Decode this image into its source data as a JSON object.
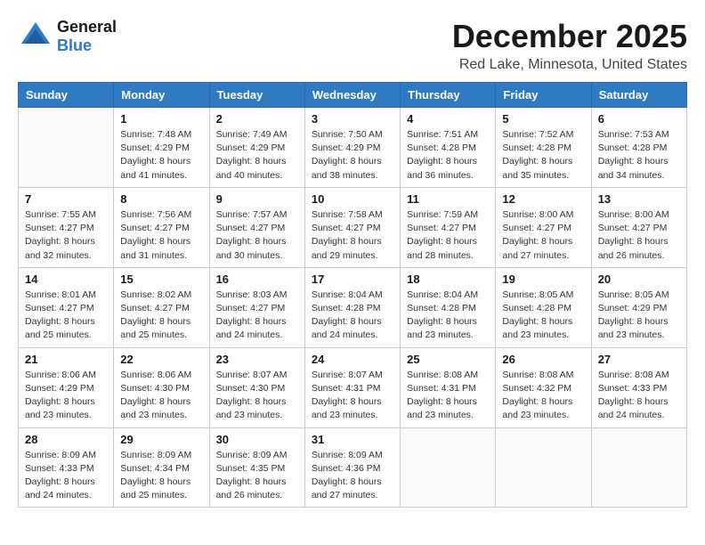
{
  "header": {
    "logo_line1": "General",
    "logo_line2": "Blue",
    "month": "December 2025",
    "location": "Red Lake, Minnesota, United States"
  },
  "calendar": {
    "days_of_week": [
      "Sunday",
      "Monday",
      "Tuesday",
      "Wednesday",
      "Thursday",
      "Friday",
      "Saturday"
    ],
    "weeks": [
      [
        {
          "day": "",
          "info": ""
        },
        {
          "day": "1",
          "info": "Sunrise: 7:48 AM\nSunset: 4:29 PM\nDaylight: 8 hours\nand 41 minutes."
        },
        {
          "day": "2",
          "info": "Sunrise: 7:49 AM\nSunset: 4:29 PM\nDaylight: 8 hours\nand 40 minutes."
        },
        {
          "day": "3",
          "info": "Sunrise: 7:50 AM\nSunset: 4:29 PM\nDaylight: 8 hours\nand 38 minutes."
        },
        {
          "day": "4",
          "info": "Sunrise: 7:51 AM\nSunset: 4:28 PM\nDaylight: 8 hours\nand 36 minutes."
        },
        {
          "day": "5",
          "info": "Sunrise: 7:52 AM\nSunset: 4:28 PM\nDaylight: 8 hours\nand 35 minutes."
        },
        {
          "day": "6",
          "info": "Sunrise: 7:53 AM\nSunset: 4:28 PM\nDaylight: 8 hours\nand 34 minutes."
        }
      ],
      [
        {
          "day": "7",
          "info": "Sunrise: 7:55 AM\nSunset: 4:27 PM\nDaylight: 8 hours\nand 32 minutes."
        },
        {
          "day": "8",
          "info": "Sunrise: 7:56 AM\nSunset: 4:27 PM\nDaylight: 8 hours\nand 31 minutes."
        },
        {
          "day": "9",
          "info": "Sunrise: 7:57 AM\nSunset: 4:27 PM\nDaylight: 8 hours\nand 30 minutes."
        },
        {
          "day": "10",
          "info": "Sunrise: 7:58 AM\nSunset: 4:27 PM\nDaylight: 8 hours\nand 29 minutes."
        },
        {
          "day": "11",
          "info": "Sunrise: 7:59 AM\nSunset: 4:27 PM\nDaylight: 8 hours\nand 28 minutes."
        },
        {
          "day": "12",
          "info": "Sunrise: 8:00 AM\nSunset: 4:27 PM\nDaylight: 8 hours\nand 27 minutes."
        },
        {
          "day": "13",
          "info": "Sunrise: 8:00 AM\nSunset: 4:27 PM\nDaylight: 8 hours\nand 26 minutes."
        }
      ],
      [
        {
          "day": "14",
          "info": "Sunrise: 8:01 AM\nSunset: 4:27 PM\nDaylight: 8 hours\nand 25 minutes."
        },
        {
          "day": "15",
          "info": "Sunrise: 8:02 AM\nSunset: 4:27 PM\nDaylight: 8 hours\nand 25 minutes."
        },
        {
          "day": "16",
          "info": "Sunrise: 8:03 AM\nSunset: 4:27 PM\nDaylight: 8 hours\nand 24 minutes."
        },
        {
          "day": "17",
          "info": "Sunrise: 8:04 AM\nSunset: 4:28 PM\nDaylight: 8 hours\nand 24 minutes."
        },
        {
          "day": "18",
          "info": "Sunrise: 8:04 AM\nSunset: 4:28 PM\nDaylight: 8 hours\nand 23 minutes."
        },
        {
          "day": "19",
          "info": "Sunrise: 8:05 AM\nSunset: 4:28 PM\nDaylight: 8 hours\nand 23 minutes."
        },
        {
          "day": "20",
          "info": "Sunrise: 8:05 AM\nSunset: 4:29 PM\nDaylight: 8 hours\nand 23 minutes."
        }
      ],
      [
        {
          "day": "21",
          "info": "Sunrise: 8:06 AM\nSunset: 4:29 PM\nDaylight: 8 hours\nand 23 minutes."
        },
        {
          "day": "22",
          "info": "Sunrise: 8:06 AM\nSunset: 4:30 PM\nDaylight: 8 hours\nand 23 minutes."
        },
        {
          "day": "23",
          "info": "Sunrise: 8:07 AM\nSunset: 4:30 PM\nDaylight: 8 hours\nand 23 minutes."
        },
        {
          "day": "24",
          "info": "Sunrise: 8:07 AM\nSunset: 4:31 PM\nDaylight: 8 hours\nand 23 minutes."
        },
        {
          "day": "25",
          "info": "Sunrise: 8:08 AM\nSunset: 4:31 PM\nDaylight: 8 hours\nand 23 minutes."
        },
        {
          "day": "26",
          "info": "Sunrise: 8:08 AM\nSunset: 4:32 PM\nDaylight: 8 hours\nand 23 minutes."
        },
        {
          "day": "27",
          "info": "Sunrise: 8:08 AM\nSunset: 4:33 PM\nDaylight: 8 hours\nand 24 minutes."
        }
      ],
      [
        {
          "day": "28",
          "info": "Sunrise: 8:09 AM\nSunset: 4:33 PM\nDaylight: 8 hours\nand 24 minutes."
        },
        {
          "day": "29",
          "info": "Sunrise: 8:09 AM\nSunset: 4:34 PM\nDaylight: 8 hours\nand 25 minutes."
        },
        {
          "day": "30",
          "info": "Sunrise: 8:09 AM\nSunset: 4:35 PM\nDaylight: 8 hours\nand 26 minutes."
        },
        {
          "day": "31",
          "info": "Sunrise: 8:09 AM\nSunset: 4:36 PM\nDaylight: 8 hours\nand 27 minutes."
        },
        {
          "day": "",
          "info": ""
        },
        {
          "day": "",
          "info": ""
        },
        {
          "day": "",
          "info": ""
        }
      ]
    ]
  }
}
